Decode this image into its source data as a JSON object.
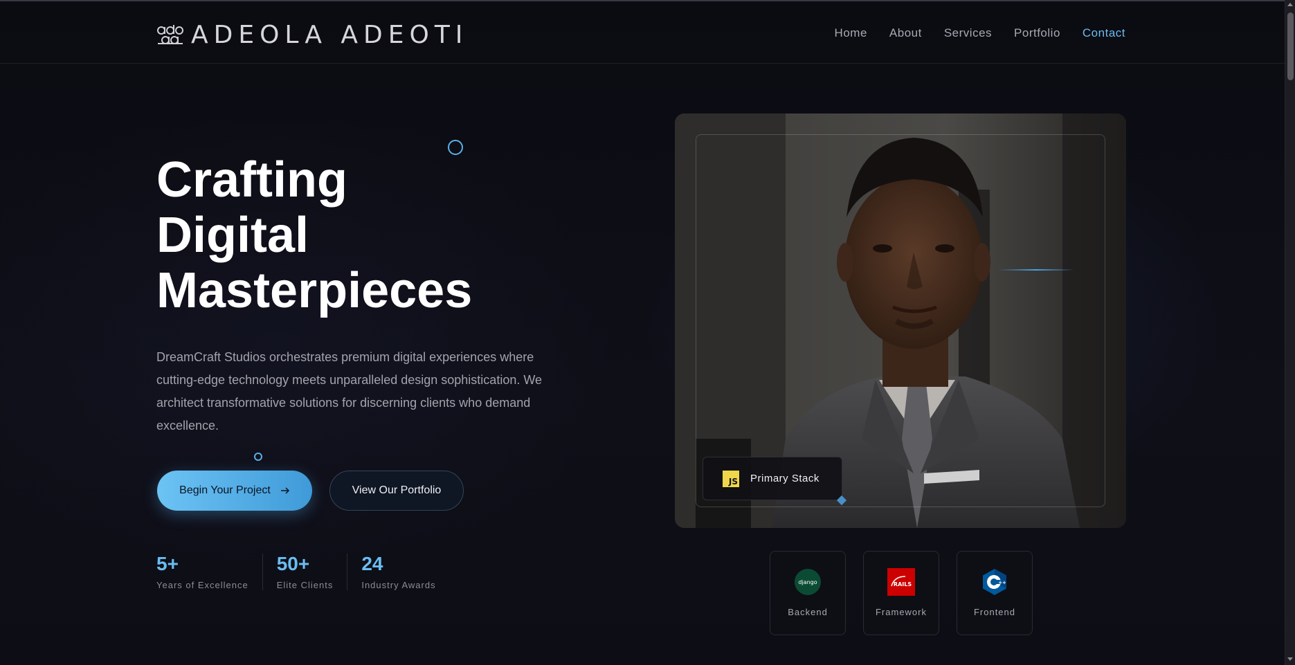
{
  "brand": {
    "name": "ADEOLA ADEOTI",
    "logo_icon": "ade-monogram-icon"
  },
  "nav": {
    "items": [
      {
        "label": "Home",
        "active": false
      },
      {
        "label": "About",
        "active": false
      },
      {
        "label": "Services",
        "active": false
      },
      {
        "label": "Portfolio",
        "active": false
      },
      {
        "label": "Contact",
        "active": true
      }
    ]
  },
  "hero": {
    "title_lines": [
      "Crafting",
      "Digital",
      "Masterpieces"
    ],
    "description": "DreamCraft Studios orchestrates premium digital experiences where cutting-edge technology meets unparalleled design sophistication. We architect transformative solutions for discerning clients who demand excellence.",
    "primary_cta": "Begin Your Project",
    "primary_cta_icon": "arrow-right-icon",
    "secondary_cta": "View Our Portfolio",
    "stats": [
      {
        "value": "5+",
        "label": "Years of Excellence"
      },
      {
        "value": "50+",
        "label": "Elite Clients"
      },
      {
        "value": "24",
        "label": "Industry Awards"
      }
    ]
  },
  "profile": {
    "photo": "portrait-photo",
    "stack_badge": {
      "label": "Primary Stack",
      "icon": "javascript-icon",
      "icon_text": "JS"
    },
    "tech": [
      {
        "label": "Backend",
        "icon": "django-icon",
        "icon_text": "django"
      },
      {
        "label": "Framework",
        "icon": "rails-icon",
        "icon_text": "RAILS"
      },
      {
        "label": "Frontend",
        "icon": "cpp-icon",
        "icon_text": "C++"
      }
    ]
  },
  "colors": {
    "accent": "#69bdf2",
    "background": "#0d0d14",
    "js_yellow": "#f0d64a",
    "rails_red": "#cc0000",
    "django_green": "#0c4b33",
    "cpp_blue": "#00599c"
  }
}
